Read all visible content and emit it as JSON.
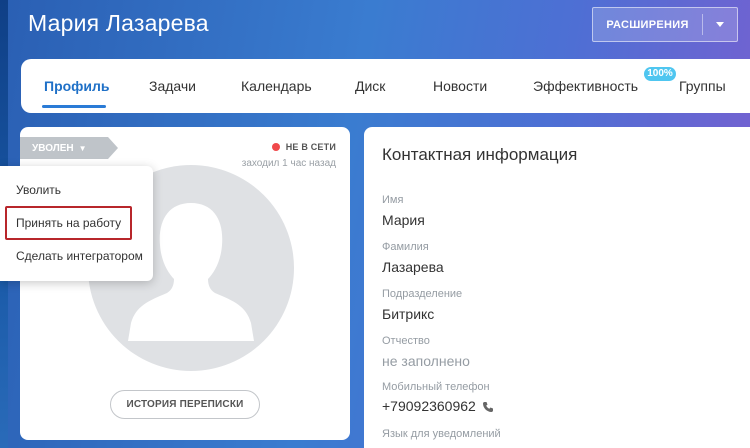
{
  "header": {
    "title": "Мария Лазарева",
    "extensions_label": "РАСШИРЕНИЯ"
  },
  "tabs": [
    {
      "label": "Профиль",
      "active": true
    },
    {
      "label": "Задачи"
    },
    {
      "label": "Календарь"
    },
    {
      "label": "Диск"
    },
    {
      "label": "Новости"
    },
    {
      "label": "Эффективность",
      "badge": "100%"
    },
    {
      "label": "Группы"
    }
  ],
  "profile": {
    "status_tag": "УВОЛЕН",
    "online_status": "НЕ В СЕТИ",
    "last_seen": "заходил 1 час назад",
    "history_button": "ИСТОРИЯ ПЕРЕПИСКИ",
    "status_color": "#f0494b"
  },
  "status_menu": {
    "items": [
      {
        "label": "Уволить"
      },
      {
        "label": "Принять на работу",
        "highlighted": true
      },
      {
        "label": "Сделать интегратором"
      }
    ]
  },
  "contact": {
    "title": "Контактная информация",
    "fields": [
      {
        "label": "Имя",
        "value": "Мария"
      },
      {
        "label": "Фамилия",
        "value": "Лазарева"
      },
      {
        "label": "Подразделение",
        "value": "Битрикс"
      },
      {
        "label": "Отчество",
        "value": "не заполнено"
      },
      {
        "label": "Мобильный телефон",
        "value": "+79092360962",
        "icon": "phone-icon"
      },
      {
        "label": "Язык для уведомлений",
        "value": ""
      }
    ]
  }
}
